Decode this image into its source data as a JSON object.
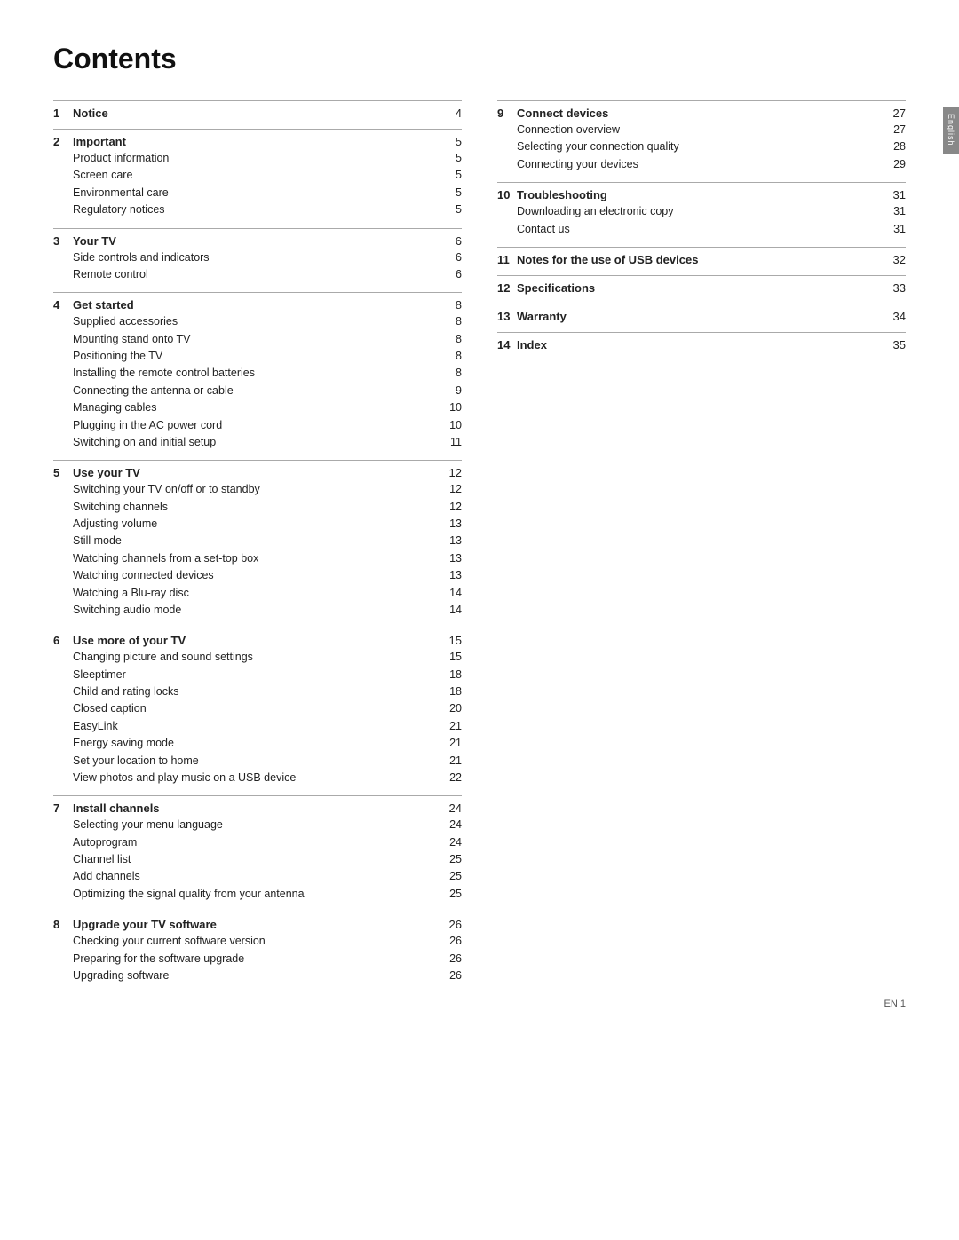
{
  "title": "Contents",
  "sidebar_label": "English",
  "footer": "EN    1",
  "left_col": [
    {
      "number": "1",
      "title": "Notice",
      "page": "4",
      "items": []
    },
    {
      "number": "2",
      "title": "Important",
      "page": "5",
      "items": [
        {
          "text": "Product information",
          "page": "5"
        },
        {
          "text": "Screen care",
          "page": "5"
        },
        {
          "text": "Environmental care",
          "page": "5"
        },
        {
          "text": "Regulatory notices",
          "page": "5"
        }
      ]
    },
    {
      "number": "3",
      "title": "Your TV",
      "page": "6",
      "items": [
        {
          "text": "Side controls and indicators",
          "page": "6"
        },
        {
          "text": "Remote control",
          "page": "6"
        }
      ]
    },
    {
      "number": "4",
      "title": "Get started",
      "page": "8",
      "items": [
        {
          "text": "Supplied accessories",
          "page": "8"
        },
        {
          "text": "Mounting stand onto TV",
          "page": "8"
        },
        {
          "text": "Positioning the TV",
          "page": "8"
        },
        {
          "text": "Installing the remote control batteries",
          "page": "8"
        },
        {
          "text": "Connecting the antenna or cable",
          "page": "9"
        },
        {
          "text": "Managing cables",
          "page": "10"
        },
        {
          "text": "Plugging in the AC power cord",
          "page": "10"
        },
        {
          "text": "Switching on and initial setup",
          "page": "11"
        }
      ]
    },
    {
      "number": "5",
      "title": "Use your TV",
      "page": "12",
      "items": [
        {
          "text": "Switching your TV on/off or to standby",
          "page": "12"
        },
        {
          "text": "Switching channels",
          "page": "12"
        },
        {
          "text": "Adjusting volume",
          "page": "13"
        },
        {
          "text": "Still mode",
          "page": "13"
        },
        {
          "text": "Watching channels from a set-top box",
          "page": "13"
        },
        {
          "text": "Watching connected devices",
          "page": "13"
        },
        {
          "text": "Watching a Blu-ray disc",
          "page": "14"
        },
        {
          "text": "Switching audio mode",
          "page": "14"
        }
      ]
    },
    {
      "number": "6",
      "title": "Use more of your TV",
      "page": "15",
      "items": [
        {
          "text": "Changing picture and sound settings",
          "page": "15"
        },
        {
          "text": "Sleeptimer",
          "page": "18"
        },
        {
          "text": "Child and rating locks",
          "page": "18"
        },
        {
          "text": "Closed caption",
          "page": "20"
        },
        {
          "text": "EasyLink",
          "page": "21"
        },
        {
          "text": "Energy saving mode",
          "page": "21"
        },
        {
          "text": "Set your location to home",
          "page": "21"
        },
        {
          "text": "View photos and play music on a USB device",
          "page": "22"
        }
      ]
    },
    {
      "number": "7",
      "title": "Install channels",
      "page": "24",
      "items": [
        {
          "text": "Selecting your menu language",
          "page": "24"
        },
        {
          "text": "Autoprogram",
          "page": "24"
        },
        {
          "text": "Channel list",
          "page": "25"
        },
        {
          "text": "Add channels",
          "page": "25"
        },
        {
          "text": "Optimizing the signal quality from your antenna",
          "page": "25"
        }
      ]
    },
    {
      "number": "8",
      "title": "Upgrade your TV software",
      "page": "26",
      "items": [
        {
          "text": "Checking your current software version",
          "page": "26"
        },
        {
          "text": "Preparing for the software upgrade",
          "page": "26"
        },
        {
          "text": "Upgrading software",
          "page": "26"
        }
      ]
    }
  ],
  "right_col": [
    {
      "number": "9",
      "title": "Connect devices",
      "page": "27",
      "items": [
        {
          "text": "Connection overview",
          "page": "27"
        },
        {
          "text": "Selecting your connection quality",
          "page": "28"
        },
        {
          "text": "Connecting your devices",
          "page": "29"
        }
      ]
    },
    {
      "number": "10",
      "title": "Troubleshooting",
      "page": "31",
      "items": [
        {
          "text": "Downloading an electronic copy",
          "page": "31"
        },
        {
          "text": "Contact us",
          "page": "31"
        }
      ]
    },
    {
      "number": "11",
      "title": "Notes for the use of USB devices",
      "page": "32",
      "items": []
    },
    {
      "number": "12",
      "title": "Specifications",
      "page": "33",
      "items": []
    },
    {
      "number": "13",
      "title": "Warranty",
      "page": "34",
      "items": []
    },
    {
      "number": "14",
      "title": "Index",
      "page": "35",
      "items": []
    }
  ]
}
